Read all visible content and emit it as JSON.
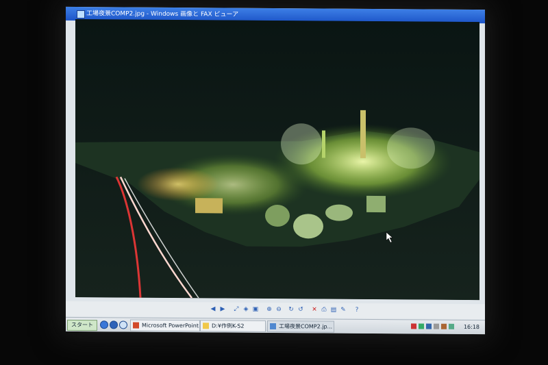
{
  "window": {
    "title": "工場夜景COMP2.jpg - Windows 画像と FAX ビューア",
    "minimize": "_",
    "maximize": "□",
    "close": "×"
  },
  "toolbar": {
    "buttons": [
      "previous-icon",
      "next-icon",
      "best-fit-icon",
      "actual-size-icon",
      "slideshow-icon",
      "zoom-in-icon",
      "zoom-out-icon",
      "rotate-cw-icon",
      "rotate-ccw-icon",
      "delete-icon",
      "print-icon",
      "save-icon",
      "edit-icon",
      "help-icon"
    ]
  },
  "taskbar": {
    "start_label": "スタート",
    "tasks": [
      {
        "label": "Microsoft PowerPoint...",
        "icon": "powerpoint-icon"
      },
      {
        "label": "D:¥作例K-S2",
        "icon": "folder-icon"
      },
      {
        "label": "工場夜景COMP2.jp...",
        "icon": "image-viewer-icon"
      }
    ],
    "clock": "16:18"
  },
  "colors": {
    "titlebar": "#1d55c8",
    "photo_bg": "#06110f",
    "lights": "#d9f27a"
  }
}
